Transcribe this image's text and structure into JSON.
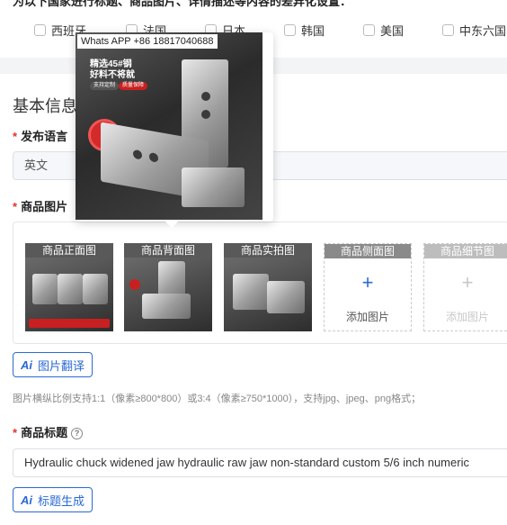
{
  "top_notice": "为以下国家进行标题、商品图片、详情描述等内容的差异化设置：",
  "countries": [
    {
      "label": "西班牙",
      "checked": false
    },
    {
      "label": "法国",
      "checked": false
    },
    {
      "label": "日本",
      "checked": false
    },
    {
      "label": "韩国",
      "checked": false
    },
    {
      "label": "美国",
      "checked": false
    },
    {
      "label": "中东六国",
      "checked": false
    }
  ],
  "section_title": "基本信息",
  "publish_language": {
    "label": "发布语言",
    "value": "英文"
  },
  "product_images": {
    "label": "商品图片",
    "slots": [
      {
        "tag": "商品正面图",
        "filled": true
      },
      {
        "tag": "商品背面图",
        "filled": true
      },
      {
        "tag": "商品实拍图",
        "filled": true
      },
      {
        "tag": "商品侧面图",
        "filled": false,
        "add_label": "添加图片"
      },
      {
        "tag": "商品细节图",
        "filled": false,
        "add_label": "添加图片"
      }
    ],
    "translate_button": "图片翻译",
    "hint": "图片横纵比例支持1:1（像素≥800*800）或3:4（像素≥750*1000），支持jpg、jpeg、png格式；"
  },
  "product_title": {
    "label": "商品标题",
    "value": "Hydraulic chuck widened jaw hydraulic raw jaw non-standard custom 5/6  inch numeric",
    "generate_button": "标题生成"
  },
  "popover": {
    "watermark": "Whats APP +86 18817040688",
    "promo_line1": "精选45#钢",
    "promo_line2": "好料不将就",
    "pill1": "支持定制",
    "pill2": "质量保障"
  },
  "colors": {
    "accent": "#2a6ad4",
    "required": "#e5322d"
  }
}
